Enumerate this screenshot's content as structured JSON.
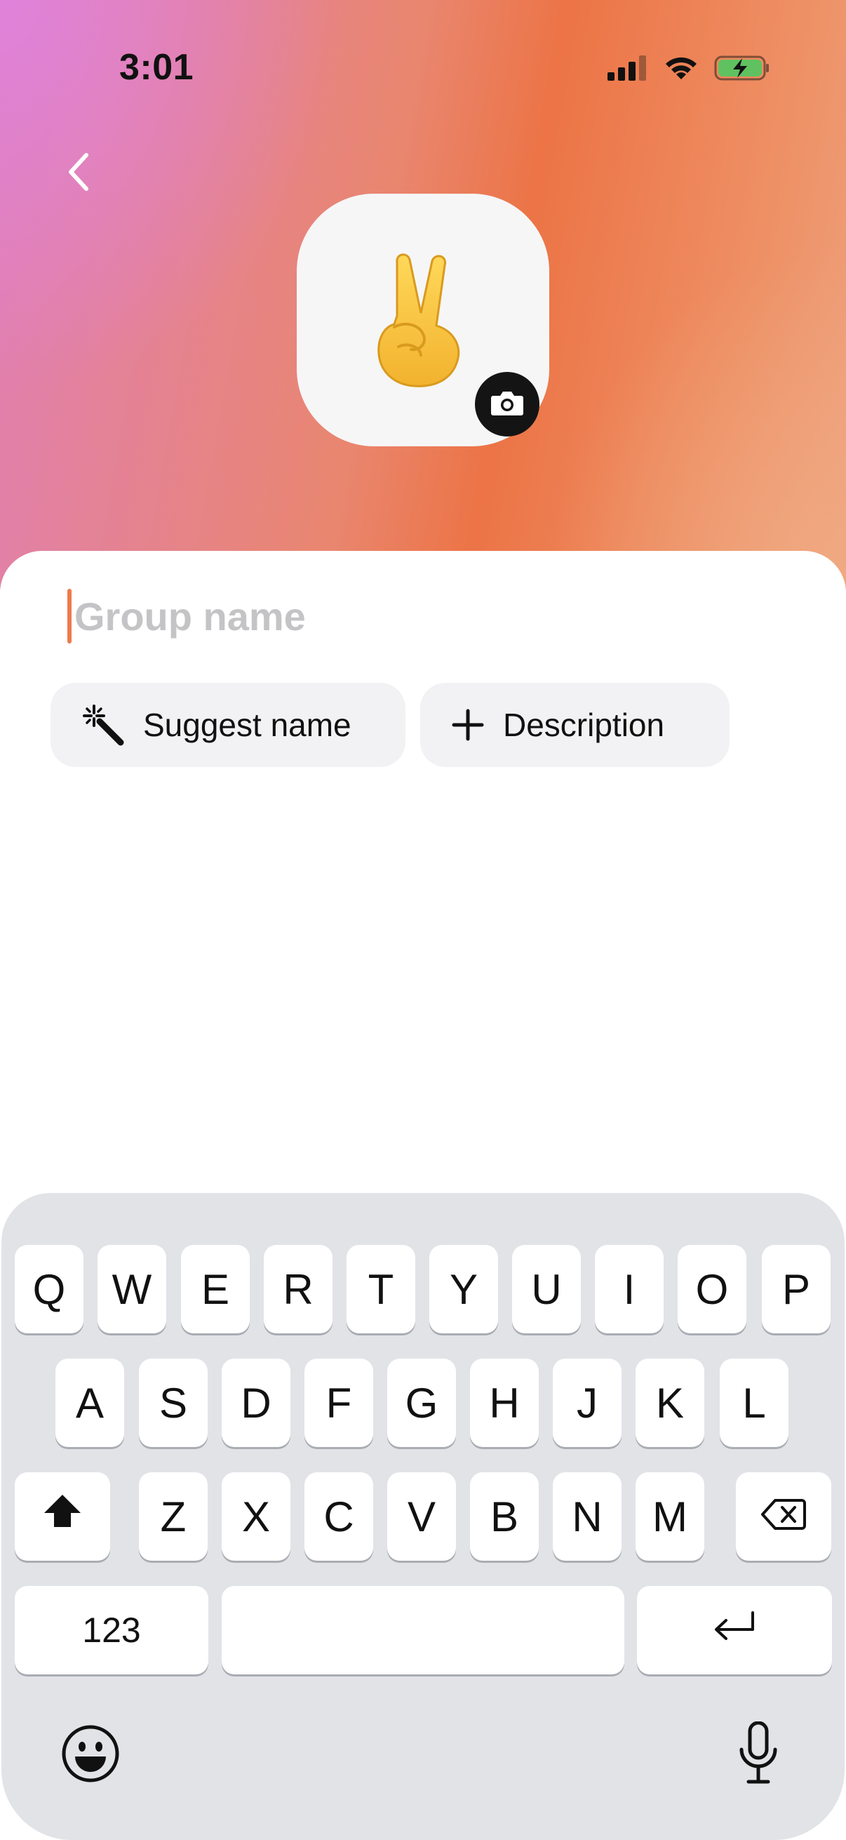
{
  "status_bar": {
    "time": "3:01",
    "icons": [
      "cellular-signal-icon",
      "wifi-icon",
      "battery-charging-icon"
    ]
  },
  "header": {
    "back_icon": "chevron-left-icon",
    "avatar_emoji": "✌️",
    "camera_icon": "camera-icon"
  },
  "form": {
    "group_name_value": "",
    "group_name_placeholder": "Group name",
    "chips": [
      {
        "icon": "magic-wand-icon",
        "label": "Suggest name"
      },
      {
        "icon": "plus-icon",
        "label": "Description"
      }
    ]
  },
  "keyboard": {
    "row1": [
      "Q",
      "W",
      "E",
      "R",
      "T",
      "Y",
      "U",
      "I",
      "O",
      "P"
    ],
    "row2": [
      "A",
      "S",
      "D",
      "F",
      "G",
      "H",
      "J",
      "K",
      "L"
    ],
    "row3": [
      "Z",
      "X",
      "C",
      "V",
      "B",
      "N",
      "M"
    ],
    "numbers_label": "123",
    "icons": [
      "shift-icon",
      "backspace-icon",
      "return-icon",
      "emoji-icon",
      "microphone-icon"
    ]
  },
  "colors": {
    "accent_caret": "#ee7a4d",
    "gradient_pink": "#e07fb6",
    "gradient_orange": "#ec7446",
    "keyboard_bg": "#e1e3e7"
  }
}
